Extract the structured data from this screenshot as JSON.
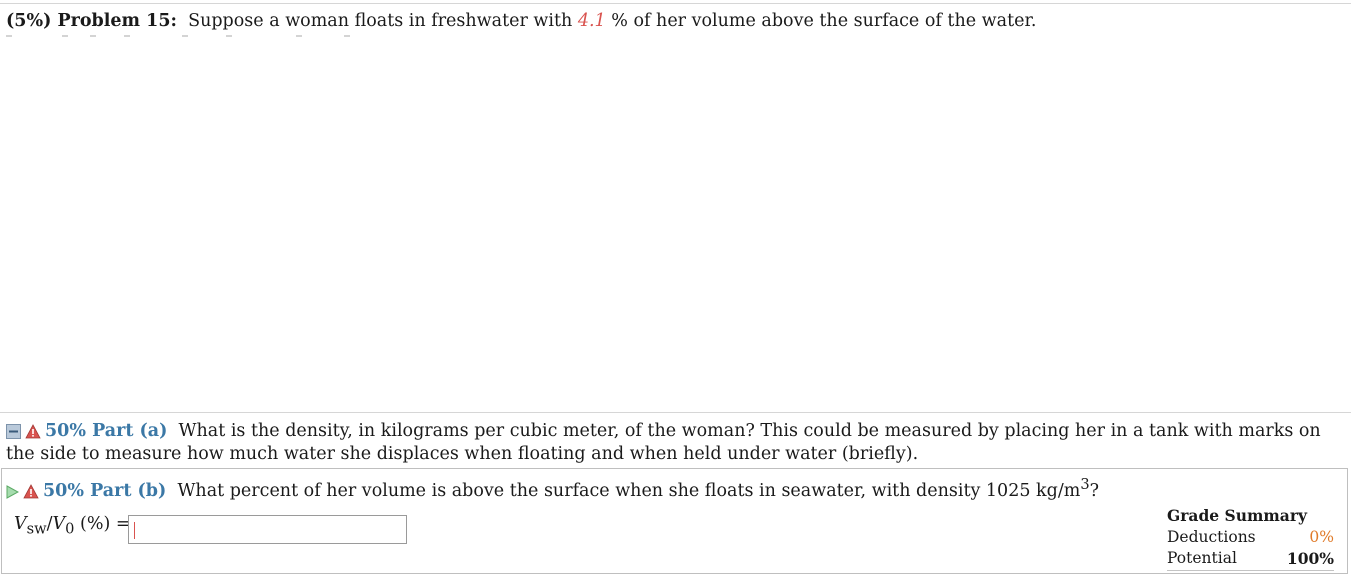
{
  "problem": {
    "label": "(5%) Problem 15:",
    "text_before": "Suppose a woman floats in freshwater with",
    "value": "4.1",
    "text_after": "% of her volume above the surface of the water."
  },
  "part_a": {
    "label": "50% Part (a)",
    "question": "What is the density, in kilograms per cubic meter, of the woman? This could be measured by placing her in a tank with marks on the side to measure how much water she displaces when floating and when held under water (briefly)."
  },
  "part_b": {
    "label": "50% Part (b)",
    "question_before": "What percent of her volume is above the surface when she floats in seawater, with density 1025 kg/m",
    "question_sup": "3",
    "question_after": "?",
    "answer_prefix": {
      "v1": "V",
      "sub1": "sw",
      "slash": "/",
      "v2": "V",
      "sub2": "0",
      "rest": " (%) ="
    },
    "answer_value": ""
  },
  "grade_summary": {
    "title": "Grade Summary",
    "deductions_label": "Deductions",
    "deductions_value": "0%",
    "potential_label": "Potential",
    "potential_value": "100%"
  },
  "colors": {
    "part_label": "#3b78a6",
    "problem_value": "#d9534f",
    "deductions_value": "#e07b2a",
    "warning_icon": "#d9534f"
  },
  "icons": {
    "part_a_toggle": "minus-box-icon",
    "part_a_status": "warning-icon",
    "part_b_toggle": "play-arrow-icon",
    "part_b_status": "warning-icon"
  }
}
